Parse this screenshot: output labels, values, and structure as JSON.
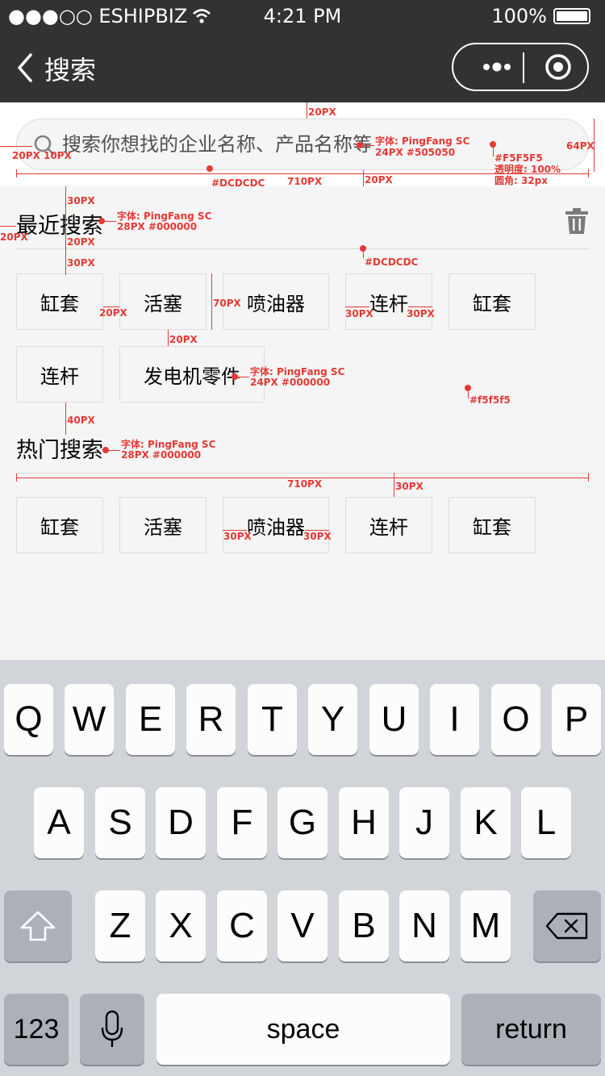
{
  "status_bar": {
    "carrier": "●●●○○ ESHIPBIZ",
    "time": "4:21 PM",
    "battery": "100%"
  },
  "nav": {
    "title": "搜索"
  },
  "search": {
    "placeholder": "搜索你想找的企业名称、产品名称等"
  },
  "recent": {
    "title": "最近搜索",
    "tags": [
      "缸套",
      "活塞",
      "喷油器",
      "连杆",
      "缸套",
      "连杆",
      "发电机零件"
    ]
  },
  "hot": {
    "title": "热门搜索",
    "tags": [
      "缸套",
      "活塞",
      "喷油器",
      "连杆",
      "缸套"
    ]
  },
  "keyboard": {
    "row1": [
      "Q",
      "W",
      "E",
      "R",
      "T",
      "Y",
      "U",
      "I",
      "O",
      "P"
    ],
    "row2": [
      "A",
      "S",
      "D",
      "F",
      "G",
      "H",
      "J",
      "K",
      "L"
    ],
    "row3": [
      "Z",
      "X",
      "C",
      "V",
      "B",
      "N",
      "M"
    ],
    "numbers": "123",
    "space": "space",
    "return": "return"
  },
  "annotations": {
    "a20_top": "20PX",
    "a_font_search": "字体: PingFang SC",
    "a_font_search_spec": "24PX #505050",
    "a64": "64PX",
    "a_bg": "#F5F5F5",
    "a_opacity": "透明度: 100%",
    "a_radius": "圆角: 32px",
    "a20_left": "20PX",
    "a10": "10PX",
    "a_border": "#DCDCDC",
    "a710": "710PX",
    "a20_bottom": "20PX",
    "a30_a": "30PX",
    "a_font_recent": "字体: PingFang SC",
    "a_font_recent_spec": "28PX #000000",
    "a20_recent_left": "20PX",
    "a20_b": "20PX",
    "a_divider": "#DCDCDC",
    "a30_b": "30PX",
    "a20_gap": "20PX",
    "a70": "70PX",
    "a30_pad_l": "30PX",
    "a30_pad_r": "30PX",
    "a20_rowgap": "20PX",
    "a_font_tag": "字体: PingFang SC",
    "a_font_tag_spec": "24PX #000000",
    "a_tag_bg": "#f5f5f5",
    "a40": "40PX",
    "a_font_hot": "字体: PingFang SC",
    "a_font_hot_spec": "28PX #000000",
    "a710_b": "710PX",
    "a30_c": "30PX",
    "a30_hot_l": "30PX",
    "a30_hot_r": "30PX"
  }
}
